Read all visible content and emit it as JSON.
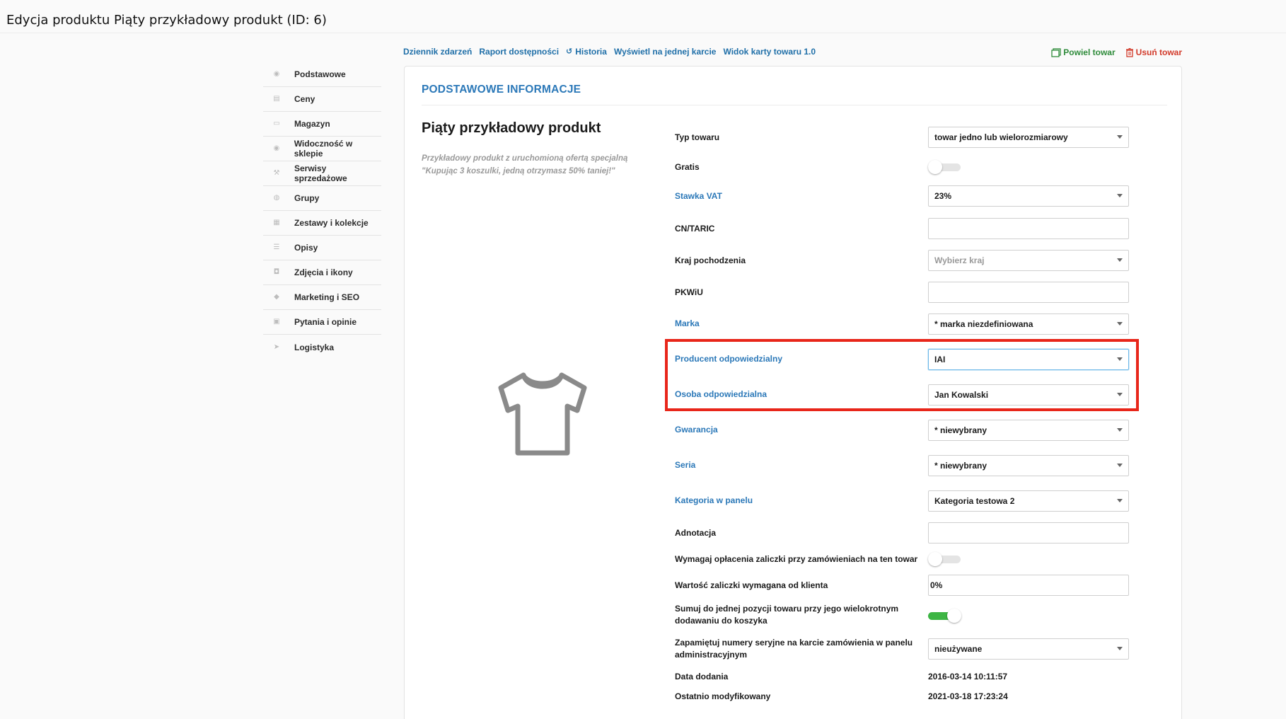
{
  "page_title": "Edycja produktu Piąty przykładowy produkt (ID: 6)",
  "sidebar": {
    "items": [
      {
        "label": "Podstawowe",
        "icon": "eye-icon"
      },
      {
        "label": "Ceny",
        "icon": "price-tag-icon"
      },
      {
        "label": "Magazyn",
        "icon": "box-icon"
      },
      {
        "label": "Widoczność w sklepie",
        "icon": "eye-icon"
      },
      {
        "label": "Serwisy sprzedażowe",
        "icon": "hammer-icon"
      },
      {
        "label": "Grupy",
        "icon": "stack-icon"
      },
      {
        "label": "Zestawy i kolekcje",
        "icon": "collection-icon"
      },
      {
        "label": "Opisy",
        "icon": "text-lines-icon"
      },
      {
        "label": "Zdjęcia i ikony",
        "icon": "camera-icon"
      },
      {
        "label": "Marketing i SEO",
        "icon": "megaphone-icon"
      },
      {
        "label": "Pytania i opinie",
        "icon": "chat-icon"
      },
      {
        "label": "Logistyka",
        "icon": "paper-plane-icon"
      }
    ]
  },
  "top_links": {
    "event_log": "Dziennik zdarzeń",
    "availability_report": "Raport dostępności",
    "history": "Historia",
    "show_on_one_card": "Wyświetl na jednej karcie",
    "product_card_view": "Widok karty towaru 1.0"
  },
  "actions": {
    "duplicate": "Powiel towar",
    "delete": "Usuń towar"
  },
  "colors": {
    "accent_blue": "#2b78b8",
    "link_blue": "#1f6fa8",
    "green": "#2e8b3a",
    "red": "#d23a2a",
    "highlight_red": "#e8261a",
    "toggle_green": "#3db544"
  },
  "section": {
    "title": "PODSTAWOWE INFORMACJE"
  },
  "product": {
    "name": "Piąty przykładowy produkt",
    "description_line1": "Przykładowy produkt z uruchomioną ofertą specjalną",
    "description_line2": "\"Kupując 3 koszulki, jedną otrzymasz 50% taniej!\"",
    "image_icon": "tshirt-icon"
  },
  "fields": {
    "typ_towaru": {
      "label": "Typ towaru",
      "value": "towar jedno lub wielorozmiarowy"
    },
    "gratis": {
      "label": "Gratis",
      "on": false
    },
    "stawka_vat": {
      "label": "Stawka VAT",
      "value": "23%"
    },
    "cn_taric": {
      "label": "CN/TARIC",
      "value": ""
    },
    "kraj": {
      "label": "Kraj pochodzenia",
      "placeholder": "Wybierz kraj"
    },
    "pkwiu": {
      "label": "PKWiU",
      "value": ""
    },
    "marka": {
      "label": "Marka",
      "value": "* marka niezdefiniowana"
    },
    "producent": {
      "label": "Producent odpowiedzialny",
      "value": "IAI"
    },
    "osoba": {
      "label": "Osoba odpowiedzialna",
      "value": "Jan Kowalski"
    },
    "gwarancja": {
      "label": "Gwarancja",
      "value": "* niewybrany"
    },
    "seria": {
      "label": "Seria",
      "value": "* niewybrany"
    },
    "kategoria": {
      "label": "Kategoria w panelu",
      "value": "Kategoria testowa 2"
    },
    "adnotacja": {
      "label": "Adnotacja",
      "value": ""
    },
    "zaliczka_wymagana": {
      "label": "Wymagaj opłacenia zaliczki przy zamówieniach na ten towar",
      "on": false
    },
    "wartosc_zaliczki": {
      "label": "Wartość zaliczki wymagana od klienta",
      "value": "0%"
    },
    "sumuj": {
      "label_line1": "Sumuj do jednej pozycji towaru przy jego wielokrotnym",
      "label_line2": "dodawaniu do koszyka",
      "on": true
    },
    "numery_seryjne": {
      "label_line1": "Zapamiętuj numery seryjne na karcie zamówienia w panelu",
      "label_line2": "administracyjnym",
      "value": "nieużywane"
    },
    "data_dodania": {
      "label": "Data dodania",
      "value": "2016-03-14 10:11:57"
    },
    "ostatnio_modyfikowany": {
      "label": "Ostatnio modyfikowany",
      "value": "2021-03-18 17:23:24"
    }
  }
}
